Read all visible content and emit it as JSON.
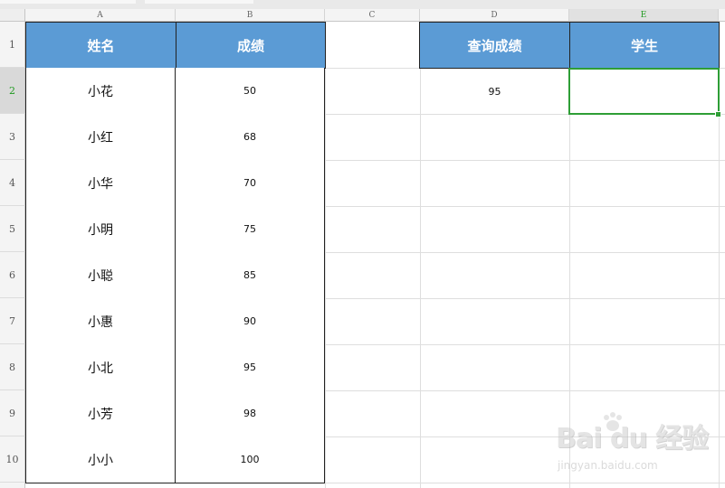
{
  "column_headers": [
    "A",
    "B",
    "C",
    "D",
    "E"
  ],
  "row_numbers": [
    "1",
    "2",
    "3",
    "4",
    "5",
    "6",
    "7",
    "8",
    "9",
    "10"
  ],
  "table": {
    "headers": {
      "name": "姓名",
      "score": "成绩"
    },
    "rows": [
      {
        "name": "小花",
        "score": "50"
      },
      {
        "name": "小红",
        "score": "68"
      },
      {
        "name": "小华",
        "score": "70"
      },
      {
        "name": "小明",
        "score": "75"
      },
      {
        "name": "小聪",
        "score": "85"
      },
      {
        "name": "小惠",
        "score": "90"
      },
      {
        "name": "小北",
        "score": "95"
      },
      {
        "name": "小芳",
        "score": "98"
      },
      {
        "name": "小小",
        "score": "100"
      }
    ]
  },
  "lookup": {
    "header_query": "查询成绩",
    "header_student": "学生",
    "query_value": "95",
    "student_value": ""
  },
  "selection": {
    "active_cell": "E2"
  },
  "watermark": {
    "logo_text": "Bai du 经验",
    "url": "jingyan.baidu.com"
  },
  "colors": {
    "header_fill": "#5b9bd5",
    "selection": "#2e9e36",
    "selected_header_text": "#1f9a1f"
  }
}
